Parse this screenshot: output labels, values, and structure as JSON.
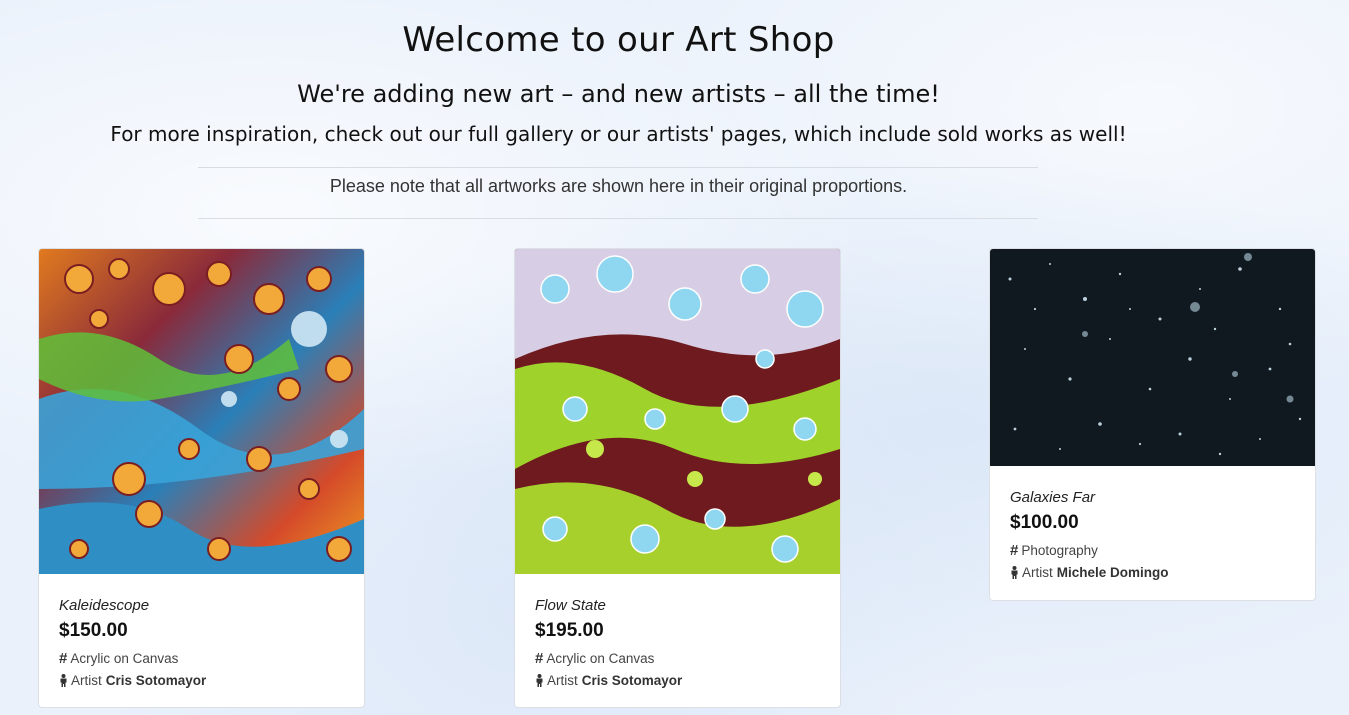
{
  "header": {
    "title": "Welcome to our Art Shop",
    "subtitle": "We're adding new art – and new artists – all the time!",
    "inspiration": "For more inspiration, check out our full gallery or our artists' pages, which include sold works as well!",
    "note": "Please note that all artworks are shown here in their original proportions."
  },
  "cards": [
    {
      "title": "Kaleidescope",
      "price": "$150.00",
      "medium": "Acrylic on Canvas",
      "artist_label": "Artist",
      "artist": "Cris Sotomayor"
    },
    {
      "title": "Flow State",
      "price": "$195.00",
      "medium": "Acrylic on Canvas",
      "artist_label": "Artist",
      "artist": "Cris Sotomayor"
    },
    {
      "title": "Galaxies Far",
      "price": "$100.00",
      "medium": "Photography",
      "artist_label": "Artist",
      "artist": "Michele Domingo"
    }
  ],
  "icons": {
    "category": "hash-icon",
    "artist": "person-icon"
  }
}
